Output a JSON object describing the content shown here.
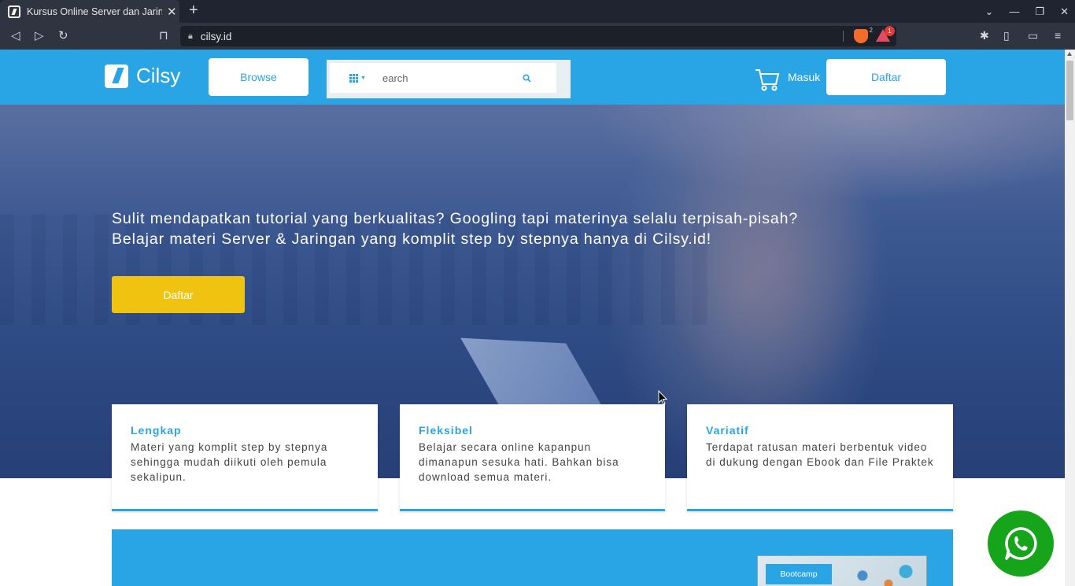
{
  "browser": {
    "tab_title": "Kursus Online Server dan Jaringan",
    "tab_close": "✕",
    "new_tab": "+",
    "url": "cilsy.id",
    "shield_count": "2",
    "rewards_count": "1"
  },
  "header": {
    "logo_text": "Cilsy",
    "browse_label": "Browse",
    "search_placeholder": "earch",
    "login_label": "Masuk",
    "register_label": "Daftar"
  },
  "hero": {
    "line1": "Sulit mendapatkan tutorial yang berkualitas? Googling tapi materinya selalu terpisah-pisah?",
    "line2": "Belajar materi Server & Jaringan yang komplit step by stepnya hanya di Cilsy.id!",
    "cta_label": "Daftar"
  },
  "features": [
    {
      "title": "Lengkap",
      "desc": "Materi yang komplit step by stepnya sehingga mudah diikuti oleh pemula sekalipun."
    },
    {
      "title": "Fleksibel",
      "desc": "Belajar secara online kapanpun dimanapun sesuka hati. Bahkan bisa download semua materi."
    },
    {
      "title": "Variatif",
      "desc": "Terdapat ratusan materi berbentuk video di dukung dengan Ebook dan File Praktek"
    }
  ],
  "banner": {
    "tag": "Bootcamp"
  },
  "colors": {
    "brand": "#29a4e4",
    "cta": "#f0c310",
    "whatsapp": "#16a41a"
  },
  "icons": [
    "cilsy-logo-icon",
    "grid-icon",
    "search-icon",
    "cart-icon",
    "whatsapp-icon"
  ]
}
